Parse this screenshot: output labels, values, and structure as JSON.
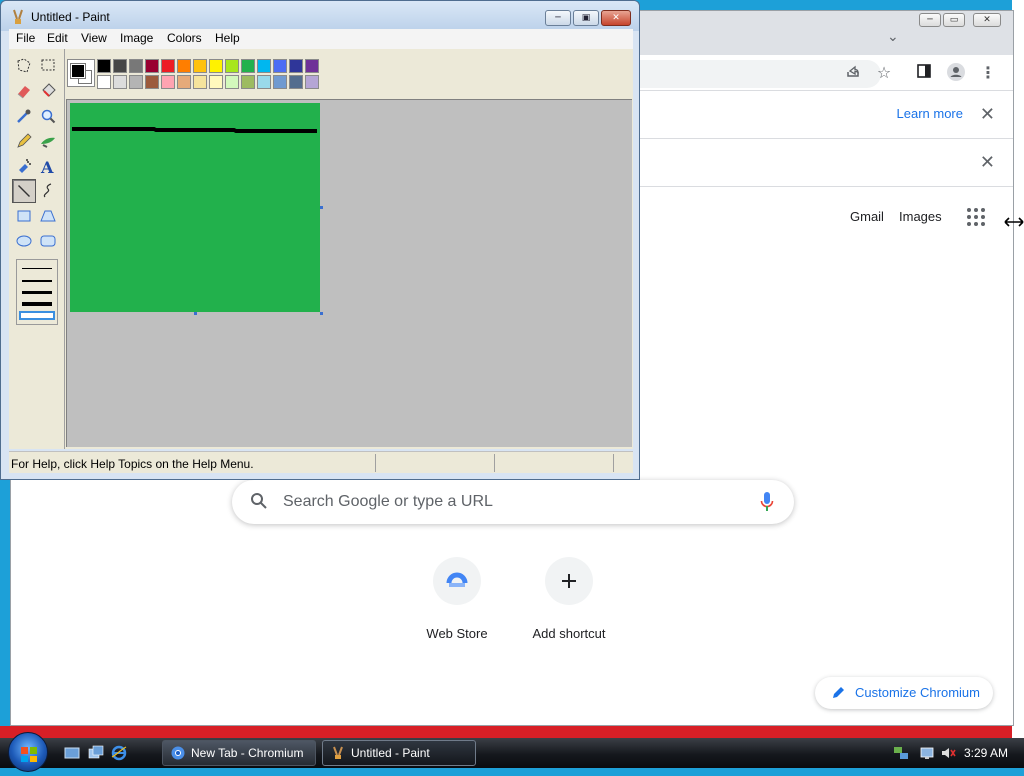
{
  "paint": {
    "title": "Untitled - Paint",
    "menu": [
      "File",
      "Edit",
      "View",
      "Image",
      "Colors",
      "Help"
    ],
    "status": "For Help, click Help Topics on the Help Menu.",
    "foreground_color": "#000000",
    "background_color": "#ffffff",
    "canvas_color": "#22b14c",
    "palette_top": [
      "#000000",
      "#464646",
      "#787878",
      "#990030",
      "#ed1c24",
      "#ff7e00",
      "#ffc20e",
      "#fff200",
      "#a8e61d",
      "#22b14c",
      "#00b7ef",
      "#4d6df3",
      "#2f3699",
      "#6f3198"
    ],
    "palette_bottom": [
      "#ffffff",
      "#dcdcdc",
      "#b4b4b4",
      "#9c5a3c",
      "#ffa3b1",
      "#e5aa7a",
      "#f5e49c",
      "#fff9bd",
      "#d3f9bc",
      "#9dbb61",
      "#99d9ea",
      "#709ad1",
      "#546d8e",
      "#b5a5d5"
    ],
    "tools": [
      "free-form-select",
      "select",
      "eraser",
      "fill-with-color",
      "pick-color",
      "magnifier",
      "pencil",
      "brush",
      "airbrush",
      "text",
      "line",
      "curve",
      "rectangle",
      "polygon",
      "ellipse",
      "rounded-rectangle"
    ],
    "selected_tool": "line"
  },
  "chrome": {
    "learn_more": "Learn more",
    "gmail": "Gmail",
    "images": "Images",
    "search_placeholder": "Search Google or type a URL",
    "shortcuts": [
      {
        "label": "Web Store",
        "icon": "web-store-icon"
      },
      {
        "label": "Add shortcut",
        "icon": "plus-icon"
      }
    ],
    "customize": "Customize Chromium",
    "accent": "#1a73e8"
  },
  "taskbar": {
    "buttons": [
      {
        "label": "New Tab - Chromium",
        "icon": "chromium-icon"
      },
      {
        "label": "Untitled - Paint",
        "icon": "paint-icon"
      }
    ],
    "clock": "3:29 AM"
  }
}
